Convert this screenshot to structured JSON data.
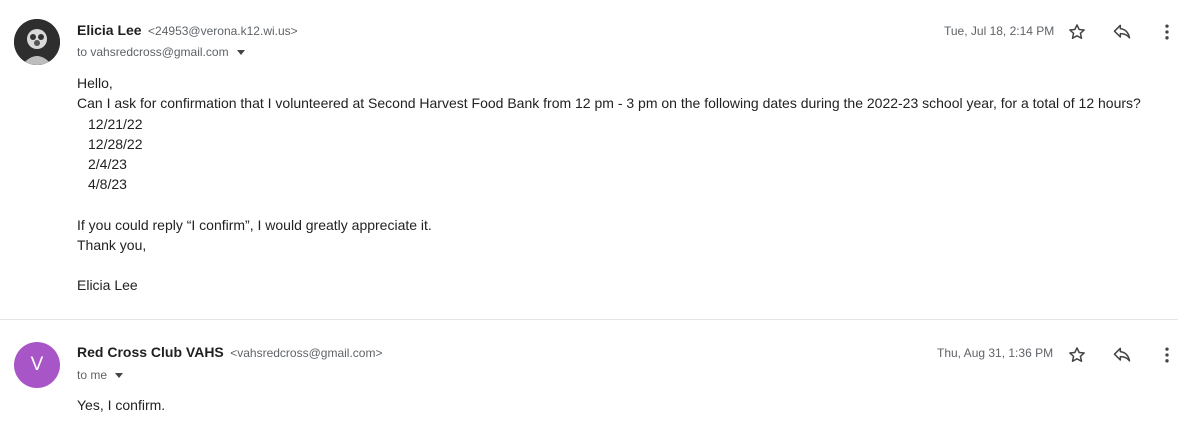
{
  "messages": [
    {
      "sender_name": "Elicia Lee",
      "sender_email": "<24953@verona.k12.wi.us>",
      "to": "to vahsredcross@gmail.com",
      "date": "Tue, Jul 18, 2:14 PM",
      "avatar_icon": "profile-photo",
      "body": {
        "greeting": "Hello,",
        "request": "Can I ask for confirmation that I volunteered at Second Harvest Food Bank from 12 pm - 3 pm on the following dates during the 2022-23 school year, for a total of 12 hours?",
        "dates": [
          "12/21/22",
          "12/28/22",
          "2/4/23",
          "4/8/23"
        ],
        "closing_request": "If you could reply “I confirm”, I would greatly appreciate it.",
        "thanks": "Thank you,",
        "signature": "Elicia Lee"
      }
    },
    {
      "sender_name": "Red Cross Club VAHS",
      "sender_email": "<vahsredcross@gmail.com>",
      "to": "to me",
      "date": "Thu, Aug 31, 1:36 PM",
      "avatar_letter": "V",
      "avatar_color": "#a855c8",
      "body": {
        "text": "Yes, I confirm."
      }
    }
  ],
  "icons": [
    "star-icon",
    "reply-icon",
    "more-vert-icon",
    "chevron-down-icon"
  ]
}
